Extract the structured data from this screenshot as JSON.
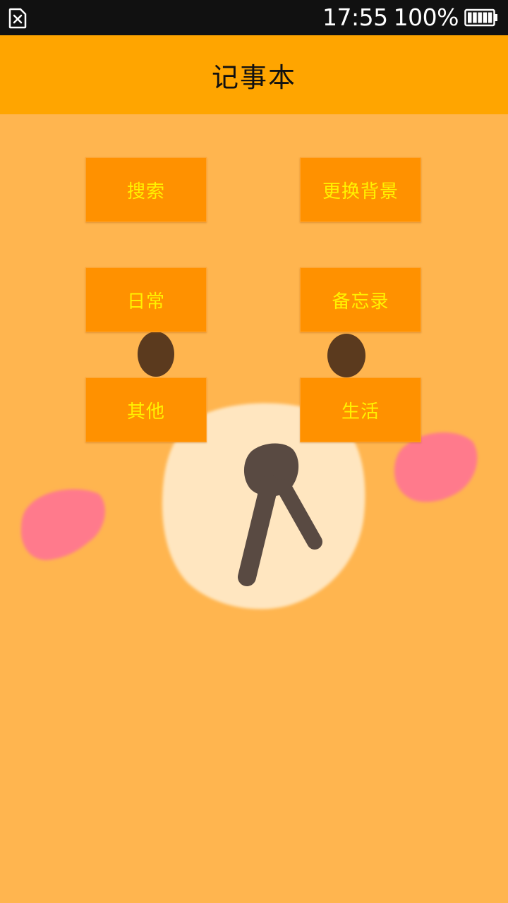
{
  "status_bar": {
    "time": "17:55",
    "battery": "100%",
    "sim_icon": "sim-card-missing-icon",
    "battery_icon": "battery-full-icon"
  },
  "header": {
    "title": "记事本",
    "background_color": "#ffa500"
  },
  "buttons": {
    "search": "搜索",
    "change_background": "更换背景",
    "daily": "日常",
    "memo": "备忘录",
    "other": "其他",
    "life": "生活"
  },
  "colors": {
    "button_bg": "#ff9100",
    "button_text": "#fff200",
    "page_bg": "#ffb54f",
    "status_bar_bg": "#111111"
  }
}
